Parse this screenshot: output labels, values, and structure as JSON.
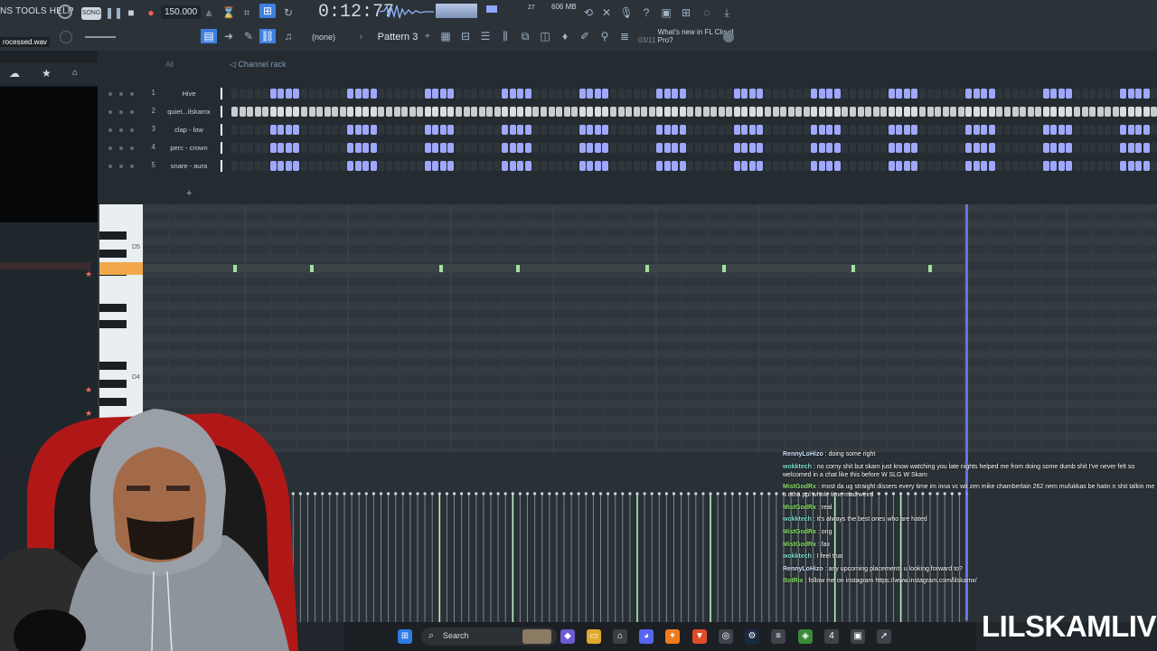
{
  "toolbar": {
    "menu": "NS TOOLS HELP",
    "song_mode": "SONG",
    "tempo": "150.000",
    "time": "0:12:77",
    "memory": "606 MB",
    "cpu_value": "27",
    "file": "rocessed.wav",
    "pattern_none": "(none)",
    "pattern": "Pattern 3",
    "news_date": "03/11",
    "news_text": "What's new in FL Cloud Pro?"
  },
  "channel_rack": {
    "title": "Channel rack",
    "filter": "All",
    "channels": [
      {
        "num": "1",
        "name": "Hive"
      },
      {
        "num": "2",
        "name": "quiet...ilskamx"
      },
      {
        "num": "3",
        "name": "clap - low"
      },
      {
        "num": "4",
        "name": "perc - crown"
      },
      {
        "num": "5",
        "name": "snare - aura"
      }
    ]
  },
  "piano_roll": {
    "label_high": "D5",
    "label_low": "D4"
  },
  "chat": [
    {
      "user": "RennyLoHizo",
      "color": "#cfe3ff",
      "text": " : doing some right"
    },
    {
      "user": "wokktech",
      "color": "#7fe0c8",
      "text": " : no corny shit but skam just know watching you late nights helped me from doing some dumb shit I've never felt so welcomed in a chat like this before W SLG W Skam"
    },
    {
      "user": "MistGodRx",
      "color": "#8be36c",
      "text": " : most da ug straight dissers every time im inna vc wit zen mike chamberlain 262 nem mufukkas be hatin n shit talkin me u otha ppl whole time mad weird"
    },
    {
      "user": "MistGodRx",
      "color": "#8be36c",
      "text": " : real"
    },
    {
      "user": "wokktech",
      "color": "#7fe0c8",
      "text": " : it's always the best ones who are hated"
    },
    {
      "user": "MistGodRx",
      "color": "#8be36c",
      "text": " : ong"
    },
    {
      "user": "MistGodRx",
      "color": "#8be36c",
      "text": " : fax"
    },
    {
      "user": "wokktech",
      "color": "#7fe0c8",
      "text": " : I feel that"
    },
    {
      "user": "RennyLoHizo",
      "color": "#cfe3ff",
      "text": " : any upcoming placements u looking forward to?"
    },
    {
      "user": "BotRix",
      "color": "#8be36c",
      "text": " : follow me on instagram https://www.instagram.com/lilskamx/"
    }
  ],
  "taskbar": {
    "search": "Search"
  },
  "brand": "LILSKAMLIVE",
  "colors": {
    "step_on": "#9fa8ff",
    "step_off": "#d9dde0",
    "accent": "#6f7dff",
    "note": "#9fe39a"
  }
}
